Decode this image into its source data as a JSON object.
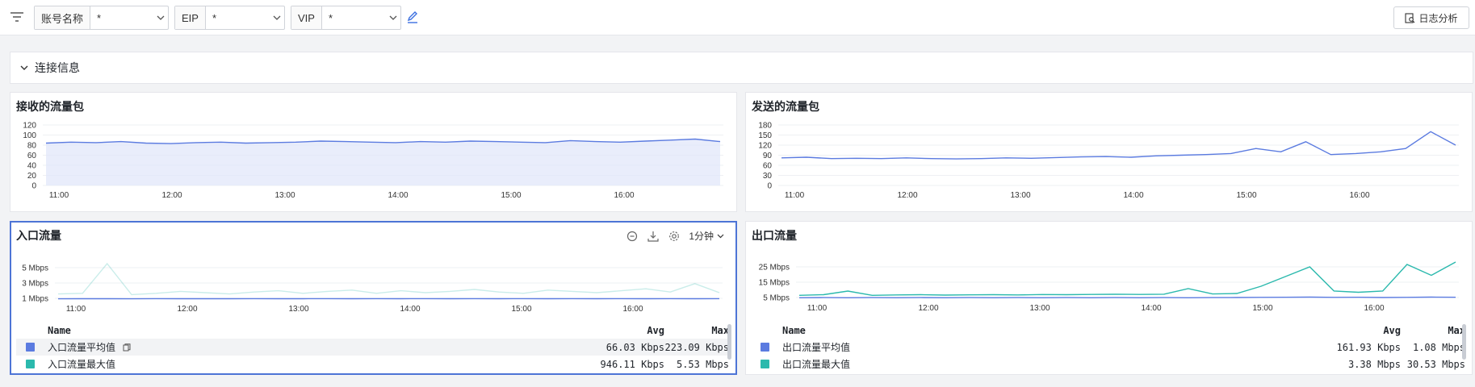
{
  "filters": [
    {
      "label": "账号名称",
      "value": "*"
    },
    {
      "label": "EIP",
      "value": "*"
    },
    {
      "label": "VIP",
      "value": "*"
    }
  ],
  "toolbar": {
    "log_button": "日志分析"
  },
  "section": {
    "title": "连接信息"
  },
  "panels": {
    "recv": {
      "title": "接收的流量包"
    },
    "send": {
      "title": "发送的流量包"
    },
    "inbound": {
      "title": "入口流量",
      "interval": "1分钟"
    },
    "outbound": {
      "title": "出口流量"
    }
  },
  "legend_headers": {
    "name": "Name",
    "avg": "Avg",
    "max": "Max"
  },
  "inbound_legend": [
    {
      "name": "入口流量平均值",
      "avg": "66.03 Kbps",
      "max": "223.09 Kbps",
      "color": "#5b7be0"
    },
    {
      "name": "入口流量最大值",
      "avg": "946.11 Kbps",
      "max": "5.53 Mbps",
      "color": "#2bb9ad"
    }
  ],
  "outbound_legend": [
    {
      "name": "出口流量平均值",
      "avg": "161.93 Kbps",
      "max": "1.08 Mbps",
      "color": "#5b7be0"
    },
    {
      "name": "出口流量最大值",
      "avg": "3.38 Mbps",
      "max": "30.53 Mbps",
      "color": "#2bb9ad"
    }
  ],
  "colors": {
    "blue": "#5b7be0",
    "teal": "#2bb9ad",
    "active_border": "#4d74d6"
  },
  "chart_data": [
    {
      "type": "area",
      "title": "接收的流量包",
      "x": [
        "11:00",
        "12:00",
        "13:00",
        "14:00",
        "15:00",
        "16:00"
      ],
      "yticks": [
        "120",
        "100",
        "80",
        "60",
        "40",
        "20",
        "0"
      ],
      "ylim": [
        0,
        120
      ],
      "series": [
        {
          "values": [
            84,
            86,
            85,
            87,
            84,
            83,
            85,
            86,
            84,
            85,
            86,
            88,
            87,
            86,
            85,
            87,
            86,
            88,
            87,
            86,
            85,
            89,
            87,
            86,
            88,
            90,
            92,
            87
          ]
        }
      ]
    },
    {
      "type": "line",
      "title": "发送的流量包",
      "x": [
        "11:00",
        "12:00",
        "13:00",
        "14:00",
        "15:00",
        "16:00"
      ],
      "yticks": [
        "180",
        "150",
        "120",
        "90",
        "60",
        "30",
        "0"
      ],
      "ylim": [
        0,
        180
      ],
      "series": [
        {
          "values": [
            82,
            84,
            80,
            81,
            80,
            82,
            80,
            79,
            80,
            82,
            81,
            83,
            85,
            86,
            84,
            88,
            90,
            92,
            95,
            110,
            100,
            130,
            92,
            95,
            100,
            110,
            160,
            120
          ]
        }
      ]
    },
    {
      "type": "line",
      "title": "入口流量",
      "x": [
        "11:00",
        "12:00",
        "13:00",
        "14:00",
        "15:00",
        "16:00"
      ],
      "yticks": [
        "5 Mbps",
        "3 Mbps",
        "1 Mbps"
      ],
      "ylim": [
        0,
        6
      ],
      "series": [
        {
          "values": [
            0.05,
            0.06,
            0.06,
            0.05,
            0.07,
            0.06,
            0.06,
            0.06,
            0.07,
            0.06,
            0.06,
            0.07,
            0.06,
            0.07,
            0.06,
            0.07,
            0.06,
            0.07,
            0.06,
            0.07,
            0.06,
            0.07,
            0.06,
            0.07,
            0.06,
            0.07,
            0.06,
            0.07
          ]
        },
        {
          "values": [
            0.8,
            0.9,
            5.5,
            0.7,
            0.9,
            1.2,
            1.0,
            0.8,
            1.1,
            1.3,
            0.9,
            1.2,
            1.4,
            0.9,
            1.3,
            1.0,
            1.2,
            1.5,
            1.1,
            0.9,
            1.4,
            1.2,
            1.0,
            1.3,
            1.6,
            1.1,
            2.4,
            1.0
          ]
        }
      ]
    },
    {
      "type": "line",
      "title": "出口流量",
      "x": [
        "11:00",
        "12:00",
        "13:00",
        "14:00",
        "15:00",
        "16:00"
      ],
      "yticks": [
        "25 Mbps",
        "15 Mbps",
        "5 Mbps"
      ],
      "ylim": [
        0,
        32
      ],
      "series": [
        {
          "values": [
            0.5,
            0.6,
            0.5,
            0.6,
            0.5,
            0.6,
            0.5,
            0.6,
            0.5,
            0.6,
            0.5,
            0.6,
            0.5,
            0.6,
            0.5,
            0.6,
            0.5,
            0.6,
            0.7,
            0.8,
            0.9,
            1.0,
            0.8,
            0.9,
            0.7,
            0.8,
            1.0,
            0.9
          ]
        },
        {
          "values": [
            2.5,
            3,
            6,
            2.5,
            2.8,
            3,
            2.7,
            2.9,
            3,
            2.8,
            3.1,
            3,
            3.2,
            3.3,
            3.2,
            3.4,
            8,
            3.6,
            4,
            10,
            18,
            26,
            6,
            5,
            6,
            28,
            19,
            30
          ]
        }
      ]
    }
  ]
}
